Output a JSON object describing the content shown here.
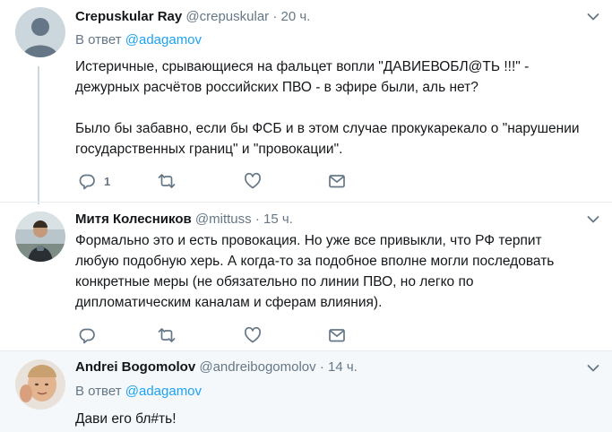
{
  "tweets": [
    {
      "name": "Crepuskular Ray",
      "handle": "@crepuskular",
      "separator": "·",
      "time": "20 ч.",
      "replying_prefix": "В ответ ",
      "replying_to": "@adagamov",
      "text": "Истеричные, срывающиеся на фальцет вопли \"ДАВИЕВОБЛ@ТЬ !!!\" -\nдежурных расчётов российских ПВО - в эфире были, аль нет?\n\nБыло бы забавно, если бы ФСБ и в этом случае прокукарекало о \"нарушении\nгосударственных границ\" и \"провокации\".",
      "reply_count": "1",
      "avatar": "default-profile-icon"
    },
    {
      "name": "Митя Колесников",
      "handle": "@mittuss",
      "separator": "·",
      "time": "15 ч.",
      "text": "Формально это и есть провокация. Но уже все привыкли, что РФ терпит\nлюбую подобную херь. А когда-то за подобное вполне могли последовать\nконкретные меры (не обязательно по линии ПВО, но легко по\nдипломатическим каналам и сферам влияния).",
      "avatar": "user-photo"
    },
    {
      "name": "Andrei Bogomolov",
      "handle": "@andreibogomolov",
      "separator": "·",
      "time": "14 ч.",
      "replying_prefix": "В ответ ",
      "replying_to": "@adagamov",
      "text": "Дави его бл#ть!",
      "avatar": "user-photo"
    }
  ],
  "icons": {
    "reply": "reply-icon",
    "retweet": "retweet-icon",
    "like": "heart-icon",
    "dm": "envelope-icon",
    "menu": "chevron-down-icon"
  },
  "colors": {
    "mention": "#1da1f2",
    "secondary_text": "#657786",
    "thread_line": "#ccd6dd",
    "highlight_bg": "#f5f8fa"
  }
}
